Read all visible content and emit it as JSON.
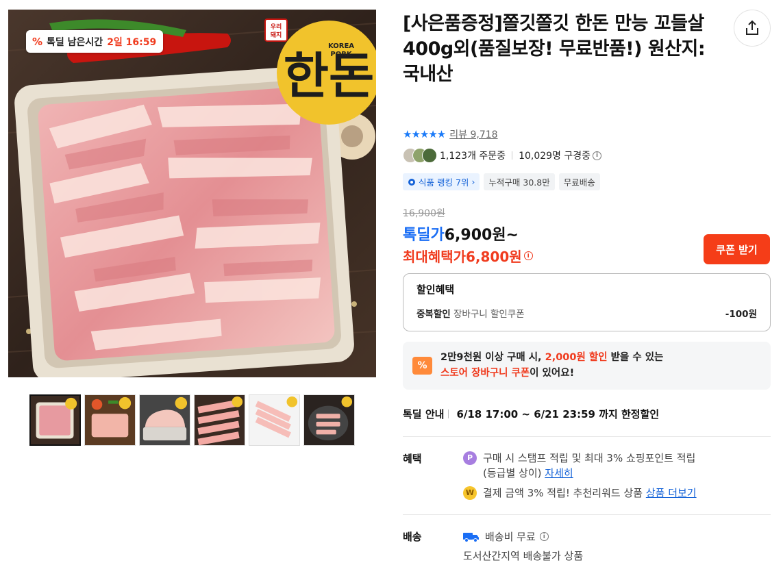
{
  "timer": {
    "icon": "percent-icon",
    "label": "톡딜 남은시간",
    "time": "2일 16:59"
  },
  "image": {
    "brand_badge": "우리돼지",
    "logo_text": "한돈",
    "logo_sub": "KOREA PORK"
  },
  "thumbnails": [
    {
      "name": "pork-tray"
    },
    {
      "name": "pork-vegetables"
    },
    {
      "name": "pork-block"
    },
    {
      "name": "pork-slices-red"
    },
    {
      "name": "pork-slices-white"
    },
    {
      "name": "pork-grilled"
    }
  ],
  "product": {
    "title": "[사은품증정]쫄깃쫄깃 한돈 만능 꼬들살 400g외(품질보장! 무료반품!) 원산지: 국내산",
    "rating_stars": "★★★★★",
    "review_link": "리뷰 9,718",
    "orders": "1,123개 주문중",
    "viewers": "10,029명 구경중"
  },
  "tags": [
    {
      "label": "식품 랭킹 7위",
      "icon": "gear-icon"
    },
    {
      "label": "누적구매 30.8만"
    },
    {
      "label": "무료배송"
    }
  ],
  "price": {
    "original": "16,900원",
    "deal_label": "톡딜가",
    "deal_value": "6,900원~",
    "max_label": "최대혜택가",
    "max_value": "6,800원",
    "coupon_button": "쿠폰 받기"
  },
  "discount": {
    "heading": "할인혜택",
    "type": "중복할인",
    "desc": "장바구니 할인쿠폰",
    "amount": "-100원"
  },
  "notice": {
    "icon": "coupon-icon",
    "pre": "2만9천원 이상 구매 시, ",
    "highlight1": "2,000원 할인",
    "mid": " 받을 수 있는",
    "highlight2": "스토어 장바구니 쿠폰",
    "post": "이 있어요!"
  },
  "deal_info": {
    "label": "톡딜 안내",
    "text": "6/18 17:00 ~ 6/21 23:59 까지 한정할인"
  },
  "benefit": {
    "label": "혜택",
    "line1": "구매 시 스탬프 적립 및 최대 3% 쇼핑포인트 적립",
    "line1b": "(등급별 상이)",
    "line1_link": "자세히",
    "line2": "결제 금액 3% 적립! 추천리워드 상품",
    "line2_link": "상품 더보기",
    "coin1": "P",
    "coin2": "W"
  },
  "shipping": {
    "label": "배송",
    "fee": "배송비 무료",
    "note": "도서산간지역 배송불가 상품"
  },
  "colors": {
    "accent_red": "#f03b1e",
    "accent_blue": "#1a6ef5",
    "coupon_button": "#f53d18"
  }
}
